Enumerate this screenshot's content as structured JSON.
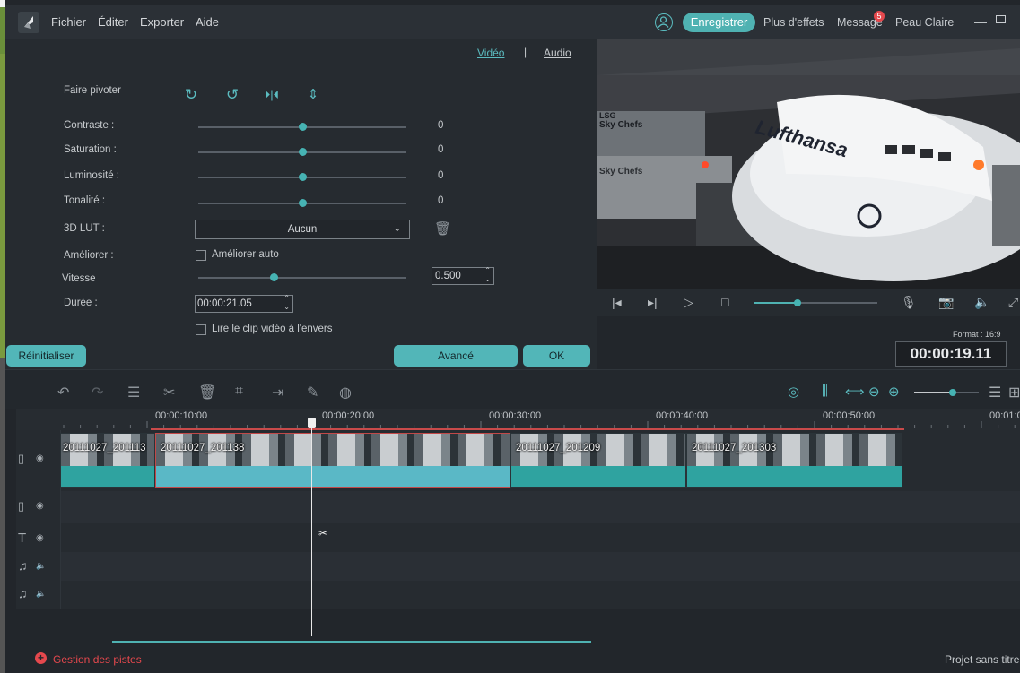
{
  "menubar": {
    "items": [
      "Fichier",
      "Éditer",
      "Exporter",
      "Aide"
    ],
    "register_label": "Enregistrer",
    "more_effects": "Plus d'effets",
    "message_label": "Message",
    "message_count": "5",
    "user_name": "Peau Claire"
  },
  "panel": {
    "tab_video": "Vidéo",
    "tab_separator": "|",
    "tab_audio": "Audio",
    "rotate_label": "Faire pivoter",
    "contrast": {
      "label": "Contraste :",
      "value": "0"
    },
    "saturation": {
      "label": "Saturation :",
      "value": "0"
    },
    "brightness": {
      "label": "Luminosité :",
      "value": "0"
    },
    "hue": {
      "label": "Tonalité :",
      "value": "0"
    },
    "lut_label": "3D LUT :",
    "lut_value": "Aucun",
    "enhance_label": "Améliorer :",
    "enhance_auto": "Améliorer auto",
    "speed_label": "Vitesse",
    "speed_value": "0.500",
    "duration_label": "Durée :",
    "duration_value": "00:00:21.05",
    "reverse_label": "Lire le clip vidéo à l'envers",
    "reset_button": "Réinitialiser",
    "advanced_button": "Avancé",
    "ok_button": "OK"
  },
  "preview": {
    "format_label": "Format : 16:9",
    "timecode": "00:00:19.11",
    "scene_text_1": "LSG",
    "scene_text_2": "Sky Chefs",
    "scene_text_3": "Lufthansa",
    "progress": 0.35
  },
  "timeline": {
    "ruler": [
      "00:00:10:00",
      "00:00:20:00",
      "00:00:30:00",
      "00:00:40:00",
      "00:00:50:00",
      "00:01:0"
    ],
    "clips": [
      "20111027_201113",
      "20111027_201138",
      "20111027_201209",
      "20111027_201303"
    ],
    "zoom_level": 0.6
  },
  "status": {
    "tracks_manage": "Gestion des pistes",
    "project_name": "Projet sans titre"
  }
}
